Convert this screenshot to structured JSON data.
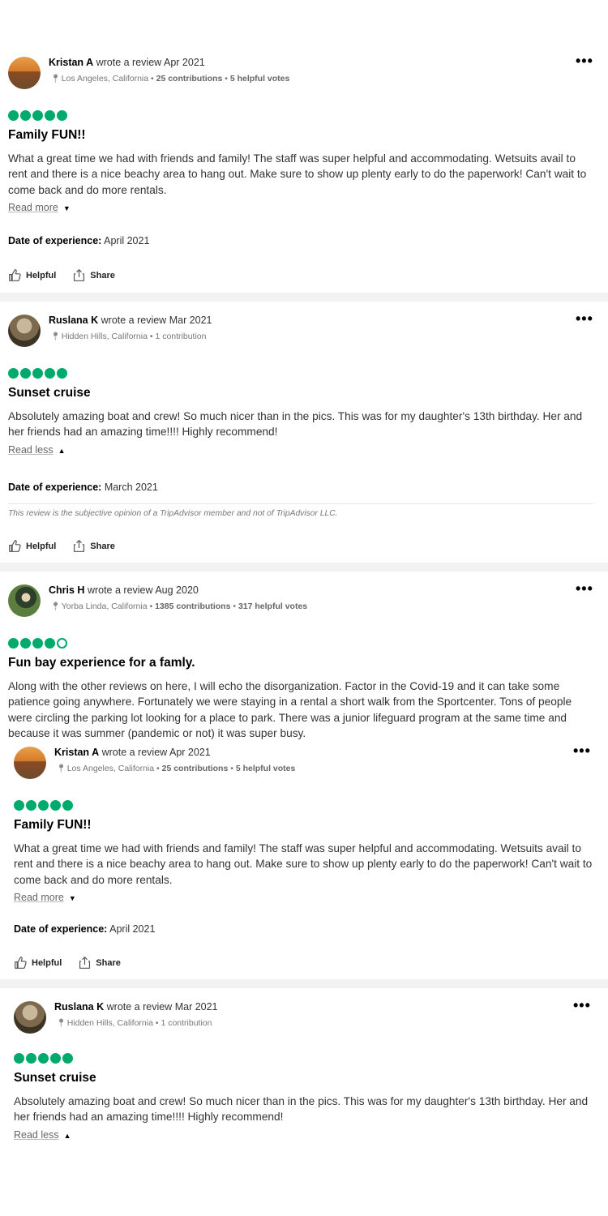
{
  "reviews": [
    {
      "author": "Kristan A",
      "action": "wrote a review",
      "date": "Apr 2021",
      "location": "Los Angeles, California",
      "contributions": "25 contributions",
      "votes": "5 helpful votes",
      "rating": 5,
      "title": "Family FUN!!",
      "body": "What a great time we had with friends and family! The staff was super helpful and accommodating. Wetsuits avail to rent and there is a nice beachy area to hang out. Make sure to show up plenty early to do the paperwork! Can't wait to come back and do more rentals.",
      "toggle": "Read more",
      "experience_label": "Date of experience:",
      "experience_date": "April 2021",
      "helpful": "Helpful",
      "share": "Share"
    },
    {
      "author": "Ruslana K",
      "action": "wrote a review",
      "date": "Mar 2021",
      "location": "Hidden Hills, California",
      "contributions": "1 contribution",
      "rating": 5,
      "title": "Sunset cruise",
      "body": "Absolutely amazing boat and crew! So much nicer than in the pics. This was for my daughter's 13th birthday. Her and her friends had an amazing time!!!! Highly recommend!",
      "toggle": "Read less",
      "experience_label": "Date of experience:",
      "experience_date": "March 2021",
      "disclaimer": "This review is the subjective opinion of a TripAdvisor member and not of TripAdvisor LLC.",
      "helpful": "Helpful",
      "share": "Share"
    },
    {
      "author": "Chris H",
      "action": "wrote a review",
      "date": "Aug 2020",
      "location": "Yorba Linda, California",
      "contributions": "1385 contributions",
      "votes": "317 helpful votes",
      "rating": 4,
      "title": "Fun bay experience for a famly.",
      "body": "Along with the other reviews on here, I will echo the disorganization. Factor in the Covid-19 and it can take some patience going anywhere. Fortunately we were staying in a rental a short walk from the Sportcenter. Tons of people were circling the parking lot looking for a place to park. There was a junior lifeguard program at the same time and because it was summer (pandemic or not) it was super busy."
    },
    {
      "author": "Kristan A",
      "action": "wrote a review",
      "date": "Apr 2021",
      "location": "Los Angeles, California",
      "contributions": "25 contributions",
      "votes": "5 helpful votes",
      "rating": 5,
      "title": "Family FUN!!",
      "body": "What a great time we had with friends and family! The staff was super helpful and accommodating. Wetsuits avail to rent and there is a nice beachy area to hang out. Make sure to show up plenty early to do the paperwork! Can't wait to come back and do more rentals.",
      "toggle": "Read more",
      "experience_label": "Date of experience:",
      "experience_date": "April 2021",
      "helpful": "Helpful",
      "share": "Share"
    },
    {
      "author": "Ruslana K",
      "action": "wrote a review",
      "date": "Mar 2021",
      "location": "Hidden Hills, California",
      "contributions": "1 contribution",
      "rating": 5,
      "title": "Sunset cruise",
      "body": "Absolutely amazing boat and crew! So much nicer than in the pics. This was for my daughter's 13th birthday. Her and her friends had an amazing time!!!! Highly recommend!",
      "toggle": "Read less"
    }
  ],
  "colors": {
    "bubble": "#00aa6c",
    "separator": "#f2f2f2",
    "muted_text": "#777777"
  },
  "icons": {
    "pin": "map-pin-icon",
    "more": "more-options-icon",
    "helpful": "thumbs-up-icon",
    "share": "share-icon",
    "toggle_down": "caret-down-icon",
    "toggle_up": "caret-up-icon"
  }
}
